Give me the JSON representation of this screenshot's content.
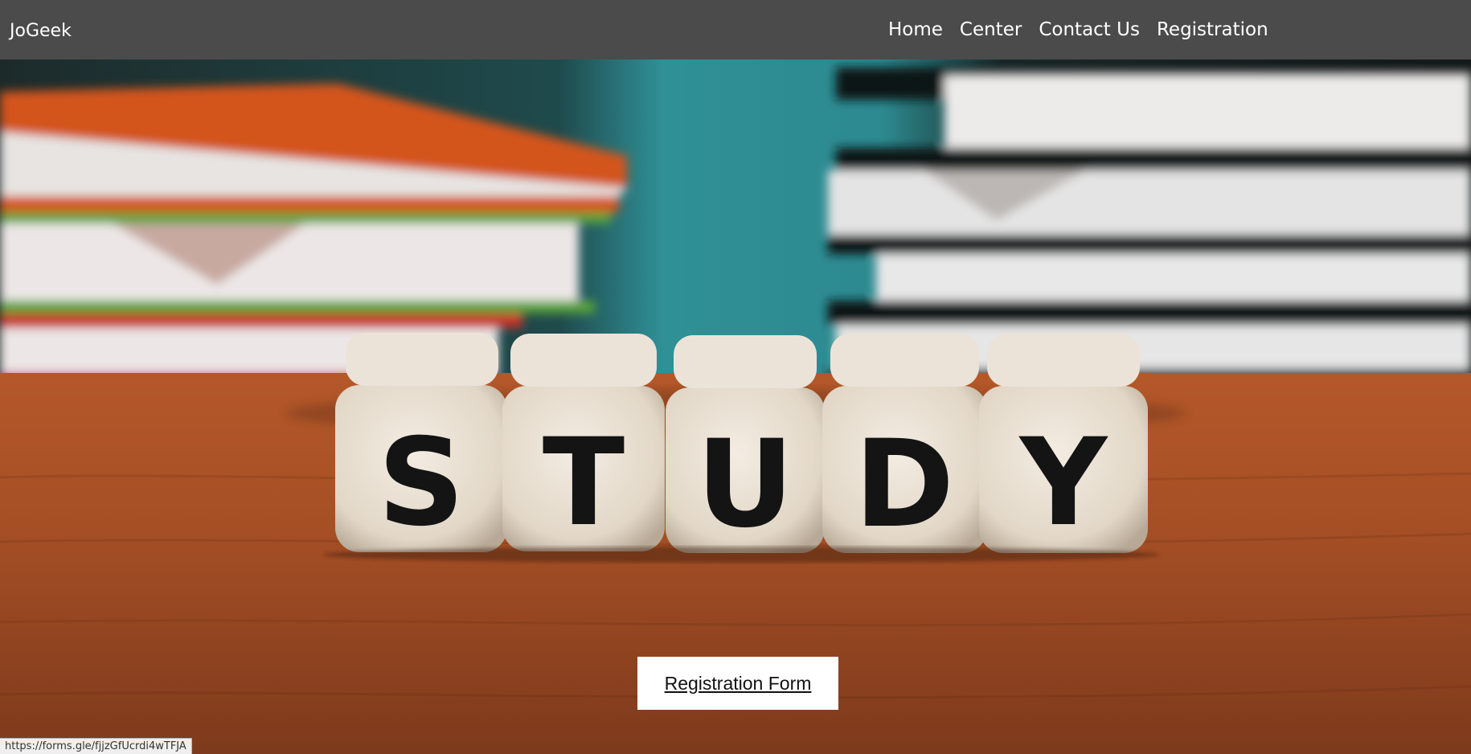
{
  "navbar": {
    "brand": "JoGeek",
    "links": [
      {
        "label": "Home"
      },
      {
        "label": "Center"
      },
      {
        "label": "Contact Us"
      },
      {
        "label": "Registration"
      }
    ]
  },
  "hero": {
    "image_subject": "wooden dice spelling STUDY on a table in front of stacked books",
    "dice_letters": [
      "S",
      "T",
      "U",
      "D",
      "Y"
    ],
    "button_label": "Registration Form"
  },
  "status_bar": {
    "url": "https://forms.gle/fjjzGfUcrdi4wTFJA"
  },
  "colors": {
    "navbar_bg": "#4b4b4b",
    "nav_text": "#ffffff",
    "button_bg": "#ffffff",
    "table_wood": "#a0522d",
    "wall_teal": "#2f8f94"
  }
}
